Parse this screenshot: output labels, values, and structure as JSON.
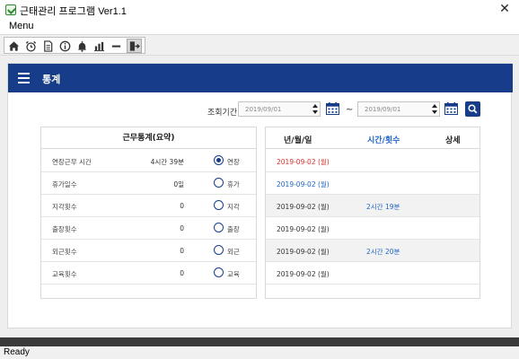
{
  "window": {
    "title": "근태관리 프로그램 Ver1.1"
  },
  "menu": {
    "label": "Menu"
  },
  "toolbar": {
    "buttons": [
      "home-icon",
      "alarm-clock-icon",
      "document-icon",
      "info-icon",
      "bell-icon",
      "bar-chart-icon",
      "minus-icon",
      "exit-icon"
    ]
  },
  "header": {
    "title": "통계"
  },
  "filter": {
    "period_label": "조회기간",
    "start_date": "2019/09/01",
    "separator": "~",
    "end_date": "2019/09/01"
  },
  "summary": {
    "title": "근무통계(요약)",
    "rows": [
      {
        "label": "연장근무 시간",
        "value": "4시간 39분",
        "option": "연장",
        "checked": true
      },
      {
        "label": "휴가일수",
        "value": "0일",
        "option": "휴가",
        "checked": false
      },
      {
        "label": "지각횟수",
        "value": "0",
        "option": "지각",
        "checked": false
      },
      {
        "label": "출장횟수",
        "value": "0",
        "option": "출장",
        "checked": false
      },
      {
        "label": "외근횟수",
        "value": "0",
        "option": "외근",
        "checked": false
      },
      {
        "label": "교육횟수",
        "value": "0",
        "option": "교육",
        "checked": false
      }
    ]
  },
  "detail": {
    "headers": {
      "date": "년/월/일",
      "time": "시간/횟수",
      "more": "상세"
    },
    "rows": [
      {
        "date": "2019-09-02 (월)",
        "time": "",
        "color": "#d9302a"
      },
      {
        "date": "2019-09-02 (월)",
        "time": "",
        "color": "#1e64c8"
      },
      {
        "date": "2019-09-02 (월)",
        "time": "2시간 19분",
        "color": "#333333"
      },
      {
        "date": "2019-09-02 (월)",
        "time": "",
        "color": "#333333"
      },
      {
        "date": "2019-09-02 (월)",
        "time": "2시간 20분",
        "color": "#333333"
      },
      {
        "date": "2019-09-02 (월)",
        "time": "",
        "color": "#333333"
      }
    ]
  },
  "status": {
    "text": "Ready"
  },
  "colors": {
    "accent": "#173d8a",
    "link": "#1e64c8",
    "alert": "#d9302a"
  }
}
